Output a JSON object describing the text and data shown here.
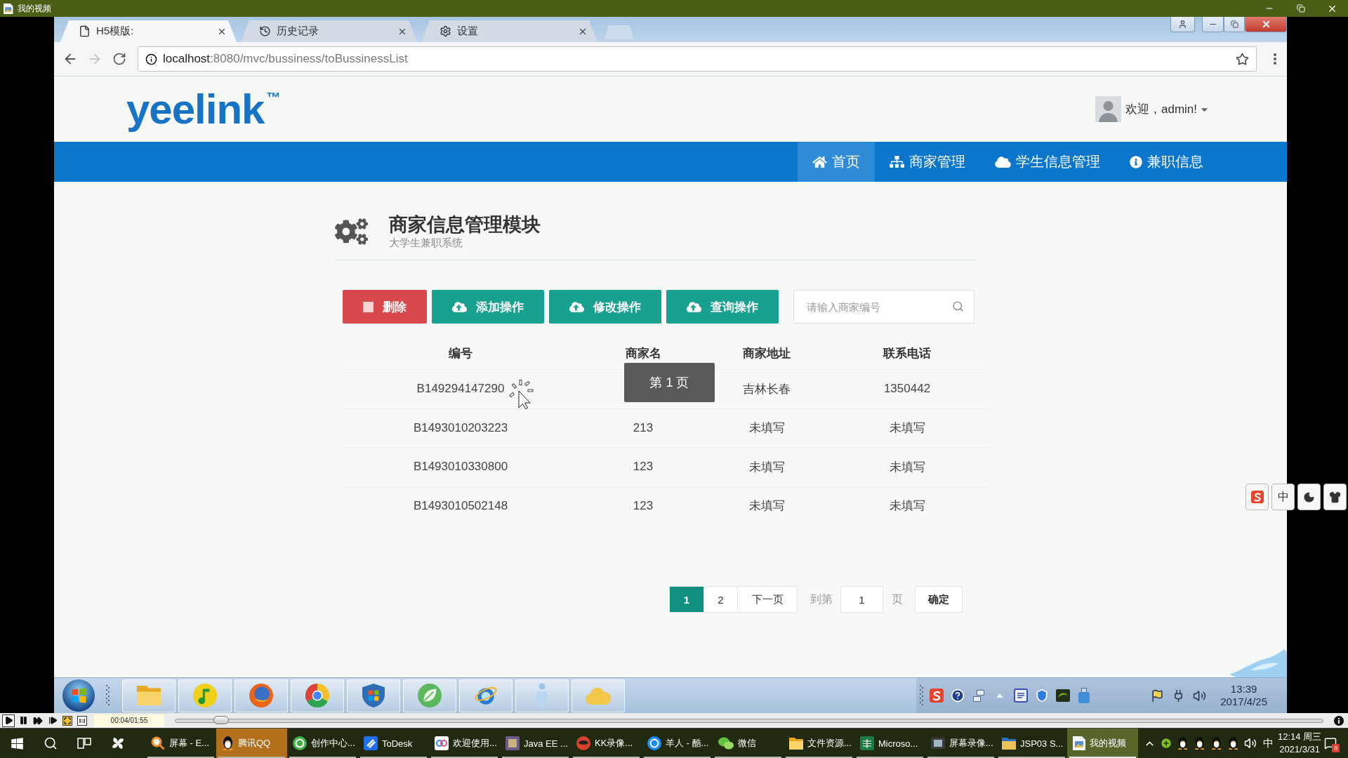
{
  "player_window": {
    "title": "我的视频"
  },
  "browser": {
    "tabs": [
      {
        "label": "H5模版:",
        "selected": true
      },
      {
        "label": "历史记录",
        "selected": false
      },
      {
        "label": "设置",
        "selected": false
      }
    ],
    "forward": {
      "disabled": true
    },
    "address": "**localhost**:8080/mvc/bussiness/toBussinessList"
  },
  "page": {
    "logo": "yeelink$^{™}$",
    "greeting": "欢迎，admin!",
    "nav": [
      {
        "label": "首页",
        "selected": true
      },
      {
        "label": "商家管理",
        "selected": false
      },
      {
        "label": "学生信息管理",
        "selected": false
      },
      {
        "label": "兼职信息",
        "selected": false
      }
    ],
    "heading": {
      "title": "商家信息管理模块",
      "subtitle": "大学生兼职系统"
    },
    "actions": [
      {
        "label": "删除",
        "kind": "danger"
      },
      {
        "label": "添加操作",
        "kind": "primary"
      },
      {
        "label": "修改操作",
        "kind": "primary"
      },
      {
        "label": "查询操作",
        "kind": "primary"
      }
    ],
    "search": {
      "placeholder": "请输入商家编号"
    },
    "table": {
      "columns": [
        "编号",
        "商家名",
        "商家地址",
        "联系电话"
      ],
      "rows": [
        {
          "id": "B149294147290",
          "address": "吉林长春",
          "phone": "1350442"
        },
        {
          "id": "B1493010203223",
          "name": "213",
          "address": "未填写",
          "phone": "未填写"
        },
        {
          "id": "B1493010330800",
          "name": "123",
          "address": "未填写",
          "phone": "未填写"
        },
        {
          "id": "B1493010502148",
          "name": "123",
          "address": "未填写",
          "phone": "未填写"
        }
      ]
    },
    "toast": "第 1 页",
    "pagination": {
      "pages": [
        {
          "label": "1",
          "selected": true
        },
        {
          "label": "2",
          "selected": false
        }
      ],
      "next": "下一页",
      "goto_label": "到第",
      "goto_value": "1",
      "goto_unit": "页",
      "confirm": "确定"
    }
  },
  "recorded_taskbar": {
    "clock_time": "13:39",
    "clock_date": "2017/4/25"
  },
  "player_controls": {
    "time": "00:04/01:55",
    "level": 0.04
  },
  "taskbar": {
    "apps": [
      {
        "label": "屏幕 - E...",
        "selected": false,
        "flashing": false
      },
      {
        "label": "腾讯QQ",
        "selected": false,
        "flashing": true
      },
      {
        "label": "创作中心...",
        "selected": false,
        "flashing": false
      },
      {
        "label": "ToDesk",
        "selected": false,
        "flashing": false
      },
      {
        "label": "欢迎使用...",
        "selected": false,
        "flashing": false
      },
      {
        "label": "Java EE ...",
        "selected": false,
        "flashing": false
      },
      {
        "label": "KK录像...",
        "selected": false,
        "flashing": false
      },
      {
        "label": "羊人 - 酷...",
        "selected": false,
        "flashing": false
      },
      {
        "label": "微信",
        "selected": false,
        "flashing": false
      },
      {
        "label": "文件资源...",
        "selected": false,
        "flashing": false
      },
      {
        "label": "Microso...",
        "selected": false,
        "flashing": false
      },
      {
        "label": "屏幕录像...",
        "selected": false,
        "flashing": false
      },
      {
        "label": "JSP03 S...",
        "selected": false,
        "flashing": false
      },
      {
        "label": "我的视频",
        "selected": true,
        "flashing": false
      }
    ],
    "ime": "中",
    "clock_time": "12:14 周三",
    "clock_date": "2021/3/31",
    "notifications": "8"
  },
  "ime_toolbar": {
    "mode": "中"
  }
}
